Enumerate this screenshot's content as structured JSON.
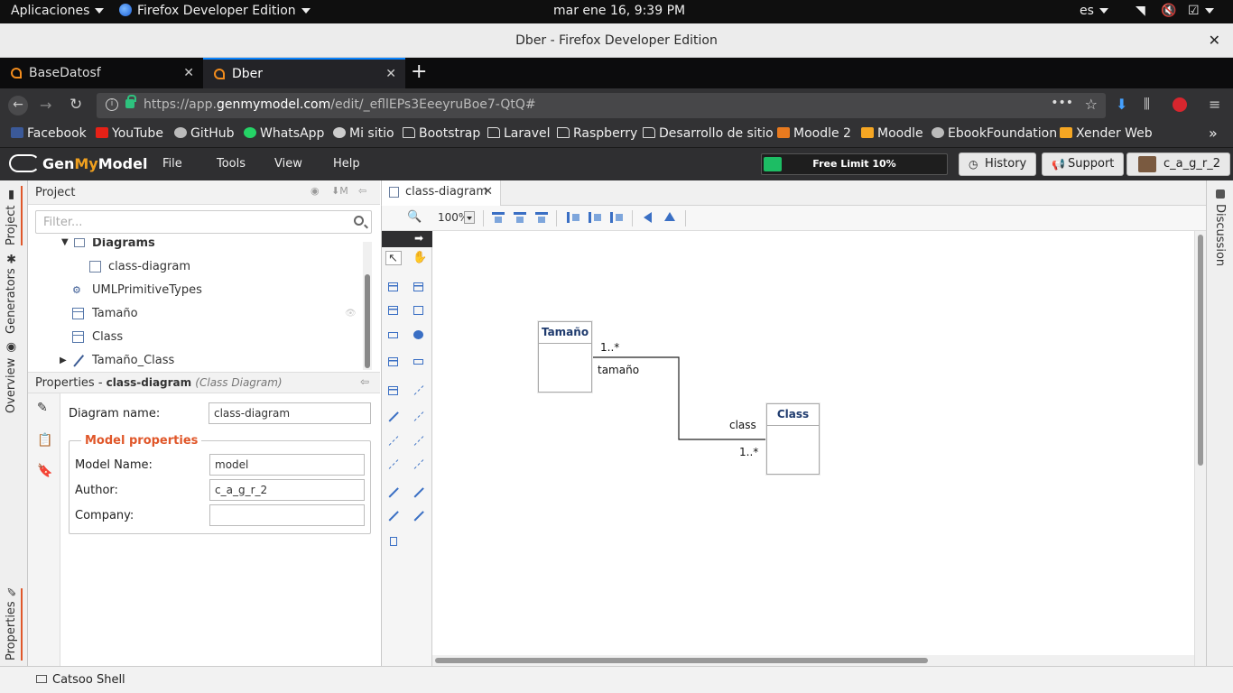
{
  "os_bar": {
    "apps_label": "Aplicaciones",
    "active_app": "Firefox Developer Edition",
    "clock": "mar ene 16,  9:39 PM",
    "lang": "es"
  },
  "window": {
    "title": "Dber - Firefox Developer Edition"
  },
  "browser": {
    "tabs": [
      {
        "label": "BaseDatosf",
        "active": false
      },
      {
        "label": "Dber",
        "active": true
      }
    ],
    "url_prefix": "https://app.",
    "url_host": "genmymodel.com",
    "url_path": "/edit/_efllEPs3EeeyruBoe7-QtQ#",
    "bookmarks": [
      {
        "label": "Facebook",
        "icon": "facebook-icon",
        "color": "#3b5998"
      },
      {
        "label": "YouTube",
        "icon": "youtube-icon",
        "color": "#e62117"
      },
      {
        "label": "GitHub",
        "icon": "github-icon",
        "color": "#bbbbbb"
      },
      {
        "label": "WhatsApp",
        "icon": "whatsapp-icon",
        "color": "#25d366"
      },
      {
        "label": "Mi sitio",
        "icon": "globe-icon",
        "color": "#cccccc"
      },
      {
        "label": "Bootstrap",
        "icon": "folder-icon",
        "color": "folder"
      },
      {
        "label": "Laravel",
        "icon": "folder-icon",
        "color": "folder"
      },
      {
        "label": "Raspberry",
        "icon": "folder-icon",
        "color": "folder"
      },
      {
        "label": "Desarrollo de sitio",
        "icon": "folder-icon",
        "color": "folder"
      },
      {
        "label": "Moodle 2",
        "icon": "moodle-icon",
        "color": "#e87a1f"
      },
      {
        "label": "Moodle",
        "icon": "moodle-icon",
        "color": "#f5a623"
      },
      {
        "label": "EbookFoundation",
        "icon": "github-icon",
        "color": "#bbbbbb"
      },
      {
        "label": "Xender Web",
        "icon": "xender-icon",
        "color": "#f5a623"
      }
    ]
  },
  "app": {
    "logo_gen": "Gen",
    "logo_my": "My",
    "logo_model": "Model",
    "menu": [
      "File",
      "Tools",
      "View",
      "Help"
    ],
    "free_limit_label": "Free Limit 10%",
    "free_limit_fraction": 0.1,
    "history_label": "History",
    "support_label": "Support",
    "user_label": "c_a_g_r_2"
  },
  "side_tabs": {
    "project": "Project",
    "generators": "Generators",
    "overview": "Overview",
    "properties": "Properties",
    "discussion": "Discussion"
  },
  "project": {
    "title": "Project",
    "filter_placeholder": "Filter...",
    "tree": [
      {
        "label": "Diagrams",
        "kind": "folder",
        "expanded": true
      },
      {
        "label": "class-diagram",
        "kind": "diagram"
      },
      {
        "label": "UMLPrimitiveTypes",
        "kind": "primitive"
      },
      {
        "label": "Tamaño",
        "kind": "class"
      },
      {
        "label": "Class",
        "kind": "class"
      },
      {
        "label": "Tamaño_Class",
        "kind": "association",
        "expanded": false
      }
    ]
  },
  "properties": {
    "header_prefix": "Properties - ",
    "header_name": "class-diagram",
    "header_type": "(Class Diagram)",
    "diagram_name_label": "Diagram name:",
    "diagram_name_value": "class-diagram",
    "model_section": "Model properties",
    "model_name_label": "Model Name:",
    "model_name_value": "model",
    "author_label": "Author:",
    "author_value": "c_a_g_r_2",
    "company_label": "Company:",
    "company_value": ""
  },
  "editor": {
    "tab_label": "class-diagram",
    "zoom": "100%"
  },
  "diagram": {
    "classes": [
      {
        "name": "Tamaño"
      },
      {
        "name": "Class"
      }
    ],
    "association": {
      "source_multiplicity": "1..*",
      "source_role": "tamaño",
      "target_role": "class",
      "target_multiplicity": "1..*"
    }
  },
  "status": {
    "shell_label": "Catsoo Shell"
  }
}
